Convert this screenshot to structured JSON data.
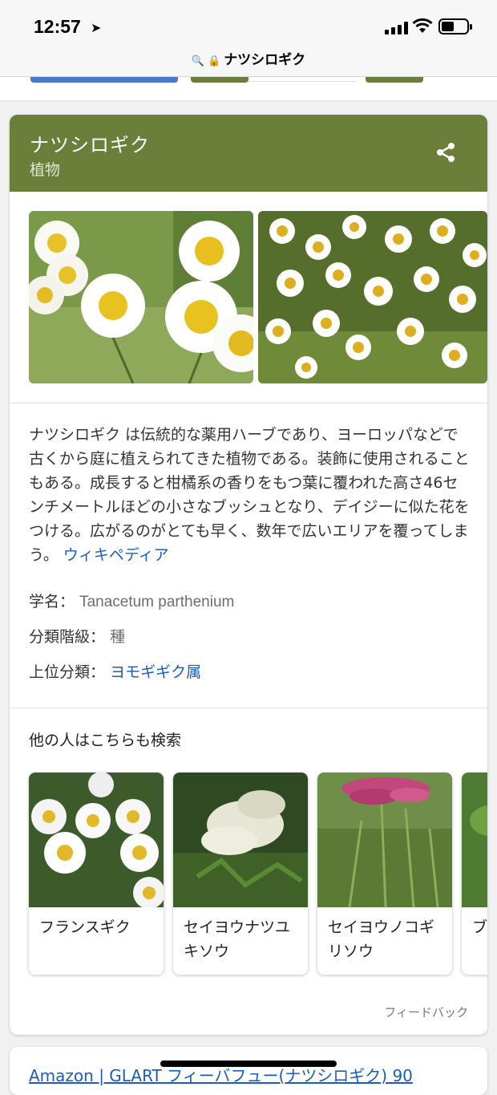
{
  "status": {
    "time": "12:57"
  },
  "address_bar": {
    "title": "ナツシロギク"
  },
  "card": {
    "title": "ナツシロギク",
    "subtitle": "植物",
    "description": "ナツシロギク は伝統的な薬用ハーブであり、ヨーロッパなどで古くから庭に植えられてきた植物である。装飾に使用されることもある。成長すると柑橘系の香りをもつ葉に覆われた高さ46センチメートルほどの小さなブッシュとなり、デイジーに似た花をつける。広がるのがとても早く、数年で広いエリアを覆ってしまう。",
    "source_link": "ウィキペディア",
    "facts": [
      {
        "label": "学名：",
        "value": "Tanacetum parthenium"
      },
      {
        "label": "分類階級：",
        "value": "種"
      },
      {
        "label": "上位分類：",
        "value": "ヨモギギク属"
      }
    ],
    "related_title": "他の人はこちらも検索",
    "related": [
      {
        "label": "フランスギク"
      },
      {
        "label": "セイヨウナツユキソウ"
      },
      {
        "label": "セイヨウノコギリソウ"
      },
      {
        "label": "ブルュ"
      }
    ],
    "feedback": "フィードバック"
  },
  "next_result": {
    "title": "Amazon | GLART フィーバフュー(ナツシロギク) 90"
  },
  "colors": {
    "header_green": "#6b7f3b",
    "link_blue": "#1a5dbf"
  }
}
